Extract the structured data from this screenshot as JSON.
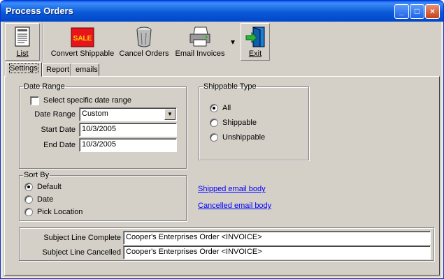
{
  "window": {
    "title": "Process Orders",
    "minimize_glyph": "_",
    "maximize_glyph": "□",
    "close_glyph": "×"
  },
  "toolbar": {
    "list": {
      "label": "List",
      "icon": "list-document-icon"
    },
    "convert": {
      "label": "Convert Shippable",
      "icon": "sale-tag-icon",
      "icon_text": "SALE"
    },
    "cancel": {
      "label": "Cancel Orders",
      "icon": "trash-can-icon"
    },
    "email": {
      "label": "Email Invoices",
      "icon": "printer-icon"
    },
    "dropdown_glyph": "▾",
    "exit": {
      "label": "Exit",
      "icon": "exit-door-icon"
    }
  },
  "tabs": [
    {
      "label": "Settings",
      "active": true
    },
    {
      "label": "Report",
      "active": false
    },
    {
      "label": "emails",
      "active": false
    }
  ],
  "date_range": {
    "legend": "Date Range",
    "specific_label": "Select specific date range",
    "specific_checked": false,
    "range_label": "Date Range",
    "range_value": "Custom",
    "range_arrow": "▼",
    "start_label": "Start Date",
    "start_value": "10/3/2005",
    "end_label": "End Date",
    "end_value": "10/3/2005"
  },
  "shippable_type": {
    "legend": "Shippable Type",
    "options": [
      {
        "label": "All",
        "selected": true
      },
      {
        "label": "Shippable",
        "selected": false
      },
      {
        "label": "Unshippable",
        "selected": false
      }
    ]
  },
  "sort_by": {
    "legend": "Sort By",
    "options": [
      {
        "label": "Default",
        "selected": true
      },
      {
        "label": "Date",
        "selected": false
      },
      {
        "label": "Pick Location",
        "selected": false
      }
    ]
  },
  "links": {
    "shipped": "Shipped email body",
    "cancelled": "Cancelled email body"
  },
  "subjects": {
    "complete_label": "Subject Line Complete",
    "complete_value": "Cooper's Enterprises Order <INVOICE>",
    "cancelled_label": "Subject Line Cancelled",
    "cancelled_value": "Cooper's Enterprises Order <INVOICE>"
  }
}
